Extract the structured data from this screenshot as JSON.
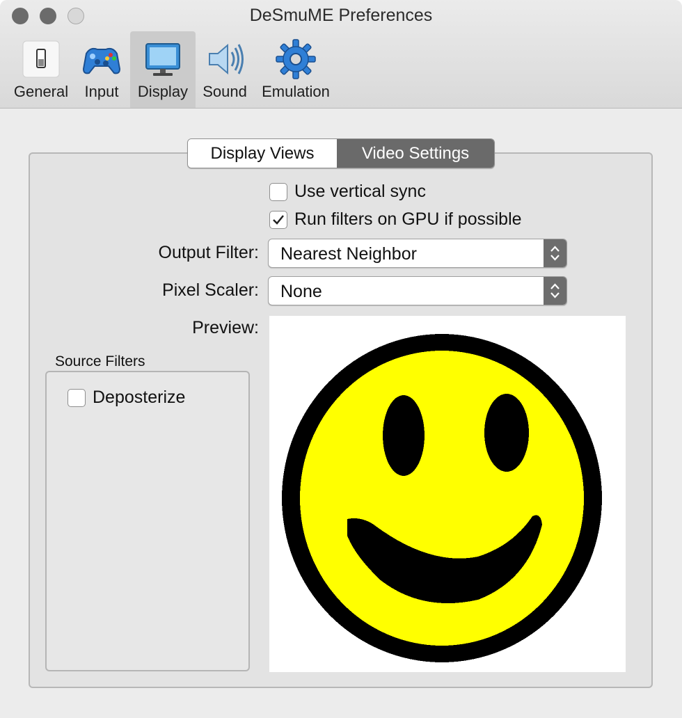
{
  "window": {
    "title": "DeSmuME Preferences"
  },
  "toolbar": {
    "items": [
      {
        "label": "General",
        "icon": "general-switch-icon",
        "selected": false
      },
      {
        "label": "Input",
        "icon": "gamepad-icon",
        "selected": false
      },
      {
        "label": "Display",
        "icon": "monitor-icon",
        "selected": true
      },
      {
        "label": "Sound",
        "icon": "speaker-icon",
        "selected": false
      },
      {
        "label": "Emulation",
        "icon": "gear-icon",
        "selected": false
      }
    ]
  },
  "tabs": {
    "items": [
      {
        "label": "Display Views",
        "selected": false
      },
      {
        "label": "Video Settings",
        "selected": true
      }
    ]
  },
  "video_settings": {
    "vsync": {
      "label": "Use vertical sync",
      "checked": false
    },
    "gpu_filters": {
      "label": "Run filters on GPU if possible",
      "checked": true
    },
    "output_filter": {
      "label": "Output Filter:",
      "value": "Nearest Neighbor"
    },
    "pixel_scaler": {
      "label": "Pixel Scaler:",
      "value": "None"
    },
    "preview": {
      "label": "Preview:",
      "image": "smiley-face-icon"
    },
    "source_filters": {
      "title": "Source Filters",
      "deposterize": {
        "label": "Deposterize",
        "checked": false
      }
    }
  },
  "colors": {
    "smiley_fill": "#ffff00",
    "smiley_outline": "#000000",
    "selected_segment": "#6a6a6a"
  }
}
